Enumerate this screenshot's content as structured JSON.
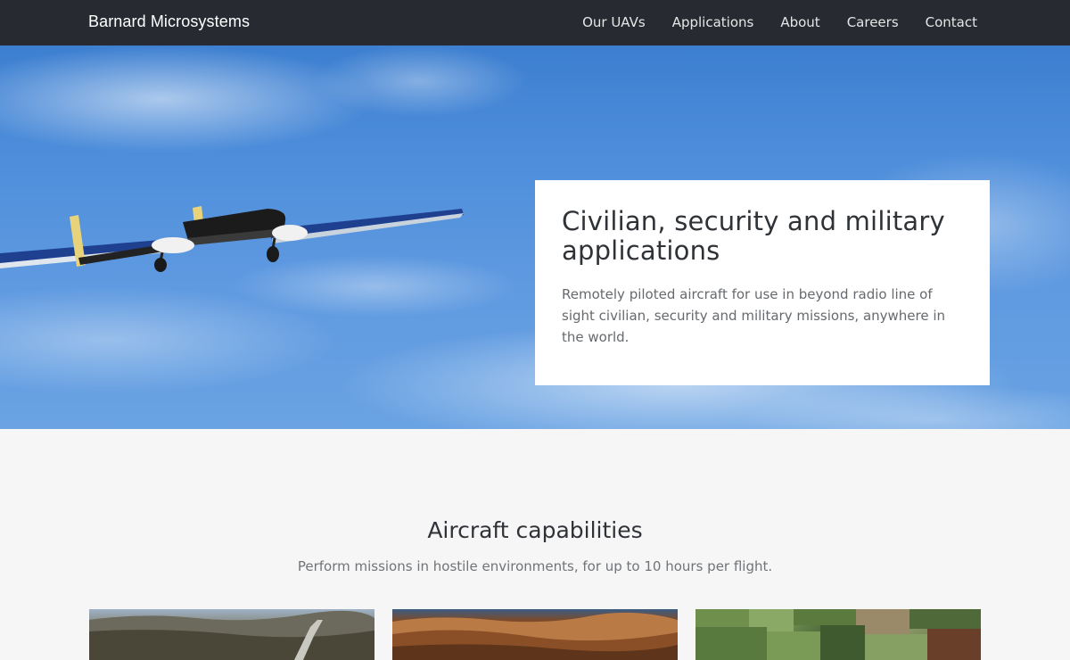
{
  "nav": {
    "brand": "Barnard Microsystems",
    "links": [
      {
        "label": "Our UAVs"
      },
      {
        "label": "Applications"
      },
      {
        "label": "About"
      },
      {
        "label": "Careers"
      },
      {
        "label": "Contact"
      }
    ]
  },
  "hero": {
    "title": "Civilian, security and military applications",
    "text": "Remotely piloted aircraft for use in beyond radio line of sight civilian, security and military missions, anywhere in the world."
  },
  "capabilities": {
    "title": "Aircraft capabilities",
    "subtitle": "Perform missions in hostile environments, for up to 10 hours per flight."
  }
}
